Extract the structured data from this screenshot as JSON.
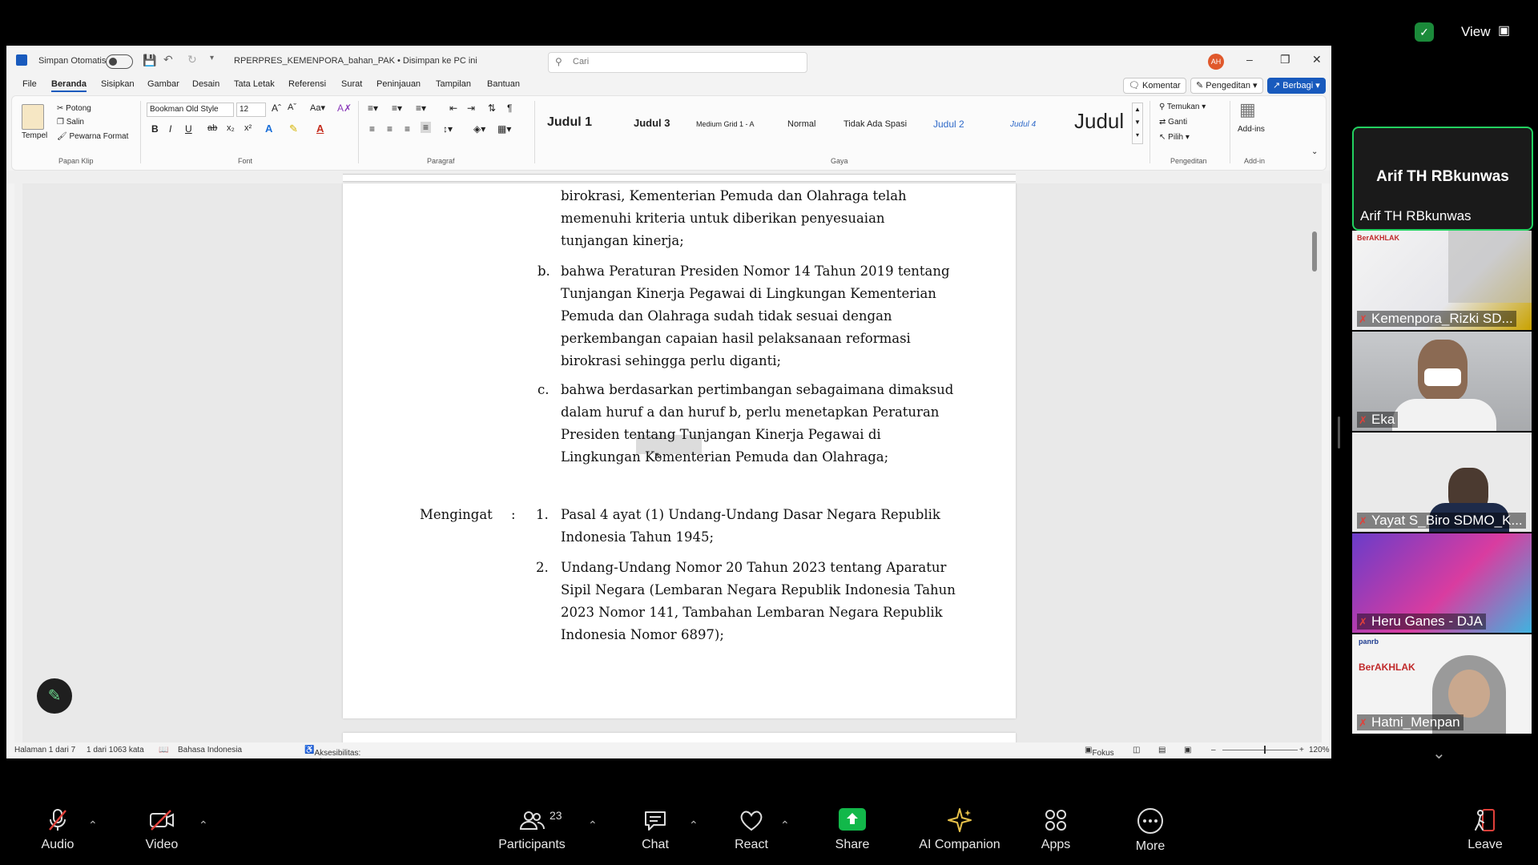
{
  "word": {
    "autosave_label": "Simpan Otomatis",
    "doc_title": "RPERPRES_KEMENPORA_bahan_PAK • Disimpan ke PC ini",
    "search_placeholder": "Cari",
    "user_initials": "AH",
    "menu": [
      "File",
      "Beranda",
      "Sisipkan",
      "Gambar",
      "Desain",
      "Tata Letak",
      "Referensi",
      "Surat",
      "Peninjauan",
      "Tampilan",
      "Bantuan"
    ],
    "comment_label": "Komentar",
    "editing_label": "Pengeditan",
    "share_label": "Berbagi",
    "ribbon": {
      "clipboard": {
        "paste": "Tempel",
        "cut": "Potong",
        "copy": "Salin",
        "format_painter": "Pewarna Format",
        "group": "Papan Klip"
      },
      "font": {
        "name": "Bookman Old Style",
        "size": "12",
        "group": "Font"
      },
      "paragraph_group": "Paragraf",
      "styles": [
        "Judul 1",
        "Judul 3",
        "Medium Grid 1 - A",
        "Normal",
        "Tidak Ada Spasi",
        "Judul 2",
        "Judul 4",
        "Judul"
      ],
      "styles_group": "Gaya",
      "editing": {
        "find": "Temukan",
        "replace": "Ganti",
        "select": "Pilih",
        "group": "Pengeditan"
      },
      "addins": {
        "label": "Add-ins",
        "group": "Add-in"
      }
    },
    "document": {
      "para_a_lines": [
        "birokrasi, Kementerian Pemuda dan Olahraga telah",
        "memenuhi kriteria untuk diberikan penyesuaian",
        "tunjangan kinerja;"
      ],
      "b_marker": "b.",
      "para_b_lines": [
        "bahwa Peraturan Presiden Nomor 14 Tahun 2019 tentang",
        "Tunjangan Kinerja Pegawai di Lingkungan Kementerian",
        "Pemuda dan Olahraga sudah tidak sesuai dengan",
        "perkembangan capaian hasil pelaksanaan reformasi",
        "birokrasi sehingga perlu diganti;"
      ],
      "c_marker": "c.",
      "para_c_lines": [
        "bahwa berdasarkan pertimbangan sebagaimana dimaksud",
        "dalam huruf a dan huruf b, perlu menetapkan Peraturan",
        "Presiden tentang Tunjangan Kinerja Pegawai di",
        "Lingkungan Kementerian Pemuda dan Olahraga;"
      ],
      "mengingat_label": "Mengingat",
      "colon": ":",
      "m1_marker": "1.",
      "m1_lines": [
        "Pasal 4 ayat (1) Undang-Undang Dasar Negara Republik",
        "Indonesia Tahun 1945;"
      ],
      "m2_marker": "2.",
      "m2_lines": [
        "Undang-Undang Nomor 20 Tahun 2023 tentang Aparatur",
        "Sipil Negara (Lembaran Negara Republik Indonesia Tahun",
        "2023 Nomor 141, Tambahan Lembaran Negara Republik",
        "Indonesia Nomor 6897);"
      ]
    },
    "status": {
      "page": "Halaman 1 dari 7",
      "words": "1 dari 1063 kata",
      "language": "Bahasa Indonesia",
      "accessibility": "Aksesibilitas: Siap digunakan",
      "focus": "Fokus",
      "zoom": "120%"
    }
  },
  "zoom": {
    "view_label": "View",
    "speaker": "Arif TH RBkunwas",
    "participants": [
      "Arif TH RBkunwas",
      "Kemenpora_Rizki SD...",
      "Eka",
      "Yayat S_Biro SDMO_K...",
      "Heru Ganes - DJA",
      "Hatni_Menpan"
    ],
    "tile_texts": {
      "berakhlak": "BerAKHLAK",
      "panrb": "panrb"
    },
    "toolbar": [
      {
        "label": "Audio"
      },
      {
        "label": "Video"
      },
      {
        "label": "Participants",
        "count": "23"
      },
      {
        "label": "Chat"
      },
      {
        "label": "React"
      },
      {
        "label": "Share"
      },
      {
        "label": "AI Companion"
      },
      {
        "label": "Apps"
      },
      {
        "label": "More"
      },
      {
        "label": "Leave"
      }
    ]
  }
}
